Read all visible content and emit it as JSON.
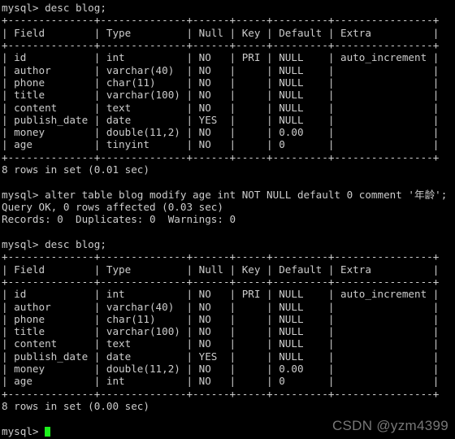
{
  "terminal": {
    "title": "mysql-client-terminal",
    "prompt": "mysql> ",
    "colors": {
      "background": "#000000",
      "foreground": "#cccccc",
      "cursor": "#1cf01c",
      "watermark": "#8c8c8c"
    },
    "lines": [
      {
        "kind": "command",
        "text": "mysql> desc blog;"
      },
      {
        "kind": "rule",
        "text": "+--------------+--------------+------+-----+---------+----------------+"
      },
      {
        "kind": "header",
        "text": "| Field        | Type         | Null | Key | Default | Extra          |"
      },
      {
        "kind": "rule",
        "text": "+--------------+--------------+------+-----+---------+----------------+"
      },
      {
        "kind": "row",
        "text": "| id           | int          | NO   | PRI | NULL    | auto_increment |"
      },
      {
        "kind": "row",
        "text": "| author       | varchar(40)  | NO   |     | NULL    |                |"
      },
      {
        "kind": "row",
        "text": "| phone        | char(11)     | NO   |     | NULL    |                |"
      },
      {
        "kind": "row",
        "text": "| title        | varchar(100) | NO   |     | NULL    |                |"
      },
      {
        "kind": "row",
        "text": "| content      | text         | NO   |     | NULL    |                |"
      },
      {
        "kind": "row",
        "text": "| publish_date | date         | YES  |     | NULL    |                |"
      },
      {
        "kind": "row",
        "text": "| money        | double(11,2) | NO   |     | 0.00    |                |"
      },
      {
        "kind": "row",
        "text": "| age          | tinyint      | NO   |     | 0       |                |"
      },
      {
        "kind": "rule",
        "text": "+--------------+--------------+------+-----+---------+----------------+"
      },
      {
        "kind": "status",
        "text": "8 rows in set (0.01 sec)"
      },
      {
        "kind": "blank",
        "text": " "
      },
      {
        "kind": "command",
        "text": "mysql> alter table blog modify age int NOT NULL default 0 comment '年龄';"
      },
      {
        "kind": "status",
        "text": "Query OK, 0 rows affected (0.03 sec)"
      },
      {
        "kind": "status",
        "text": "Records: 0  Duplicates: 0  Warnings: 0"
      },
      {
        "kind": "blank",
        "text": " "
      },
      {
        "kind": "command",
        "text": "mysql> desc blog;"
      },
      {
        "kind": "rule",
        "text": "+--------------+--------------+------+-----+---------+----------------+"
      },
      {
        "kind": "header",
        "text": "| Field        | Type         | Null | Key | Default | Extra          |"
      },
      {
        "kind": "rule",
        "text": "+--------------+--------------+------+-----+---------+----------------+"
      },
      {
        "kind": "row",
        "text": "| id           | int          | NO   | PRI | NULL    | auto_increment |"
      },
      {
        "kind": "row",
        "text": "| author       | varchar(40)  | NO   |     | NULL    |                |"
      },
      {
        "kind": "row",
        "text": "| phone        | char(11)     | NO   |     | NULL    |                |"
      },
      {
        "kind": "row",
        "text": "| title        | varchar(100) | NO   |     | NULL    |                |"
      },
      {
        "kind": "row",
        "text": "| content      | text         | NO   |     | NULL    |                |"
      },
      {
        "kind": "row",
        "text": "| publish_date | date         | YES  |     | NULL    |                |"
      },
      {
        "kind": "row",
        "text": "| money        | double(11,2) | NO   |     | 0.00    |                |"
      },
      {
        "kind": "row",
        "text": "| age          | int          | NO   |     | 0       |                |"
      },
      {
        "kind": "rule",
        "text": "+--------------+--------------+------+-----+---------+----------------+"
      },
      {
        "kind": "status",
        "text": "8 rows in set (0.00 sec)"
      },
      {
        "kind": "blank",
        "text": " "
      }
    ],
    "active_prompt": "mysql> ",
    "tables": [
      {
        "name": "blog-describe-before",
        "columns": [
          "Field",
          "Type",
          "Null",
          "Key",
          "Default",
          "Extra"
        ],
        "rows": [
          [
            "id",
            "int",
            "NO",
            "PRI",
            "NULL",
            "auto_increment"
          ],
          [
            "author",
            "varchar(40)",
            "NO",
            "",
            "NULL",
            ""
          ],
          [
            "phone",
            "char(11)",
            "NO",
            "",
            "NULL",
            ""
          ],
          [
            "title",
            "varchar(100)",
            "NO",
            "",
            "NULL",
            ""
          ],
          [
            "content",
            "text",
            "NO",
            "",
            "NULL",
            ""
          ],
          [
            "publish_date",
            "date",
            "YES",
            "",
            "NULL",
            ""
          ],
          [
            "money",
            "double(11,2)",
            "NO",
            "",
            "0.00",
            ""
          ],
          [
            "age",
            "tinyint",
            "NO",
            "",
            "0",
            ""
          ]
        ],
        "result": "8 rows in set (0.01 sec)"
      },
      {
        "name": "blog-describe-after",
        "columns": [
          "Field",
          "Type",
          "Null",
          "Key",
          "Default",
          "Extra"
        ],
        "rows": [
          [
            "id",
            "int",
            "NO",
            "PRI",
            "NULL",
            "auto_increment"
          ],
          [
            "author",
            "varchar(40)",
            "NO",
            "",
            "NULL",
            ""
          ],
          [
            "phone",
            "char(11)",
            "NO",
            "",
            "NULL",
            ""
          ],
          [
            "title",
            "varchar(100)",
            "NO",
            "",
            "NULL",
            ""
          ],
          [
            "content",
            "text",
            "NO",
            "",
            "NULL",
            ""
          ],
          [
            "publish_date",
            "date",
            "YES",
            "",
            "NULL",
            ""
          ],
          [
            "money",
            "double(11,2)",
            "NO",
            "",
            "0.00",
            ""
          ],
          [
            "age",
            "int",
            "NO",
            "",
            "0",
            ""
          ]
        ],
        "result": "8 rows in set (0.00 sec)"
      }
    ]
  },
  "watermark": {
    "text": "CSDN @yzm4399"
  }
}
